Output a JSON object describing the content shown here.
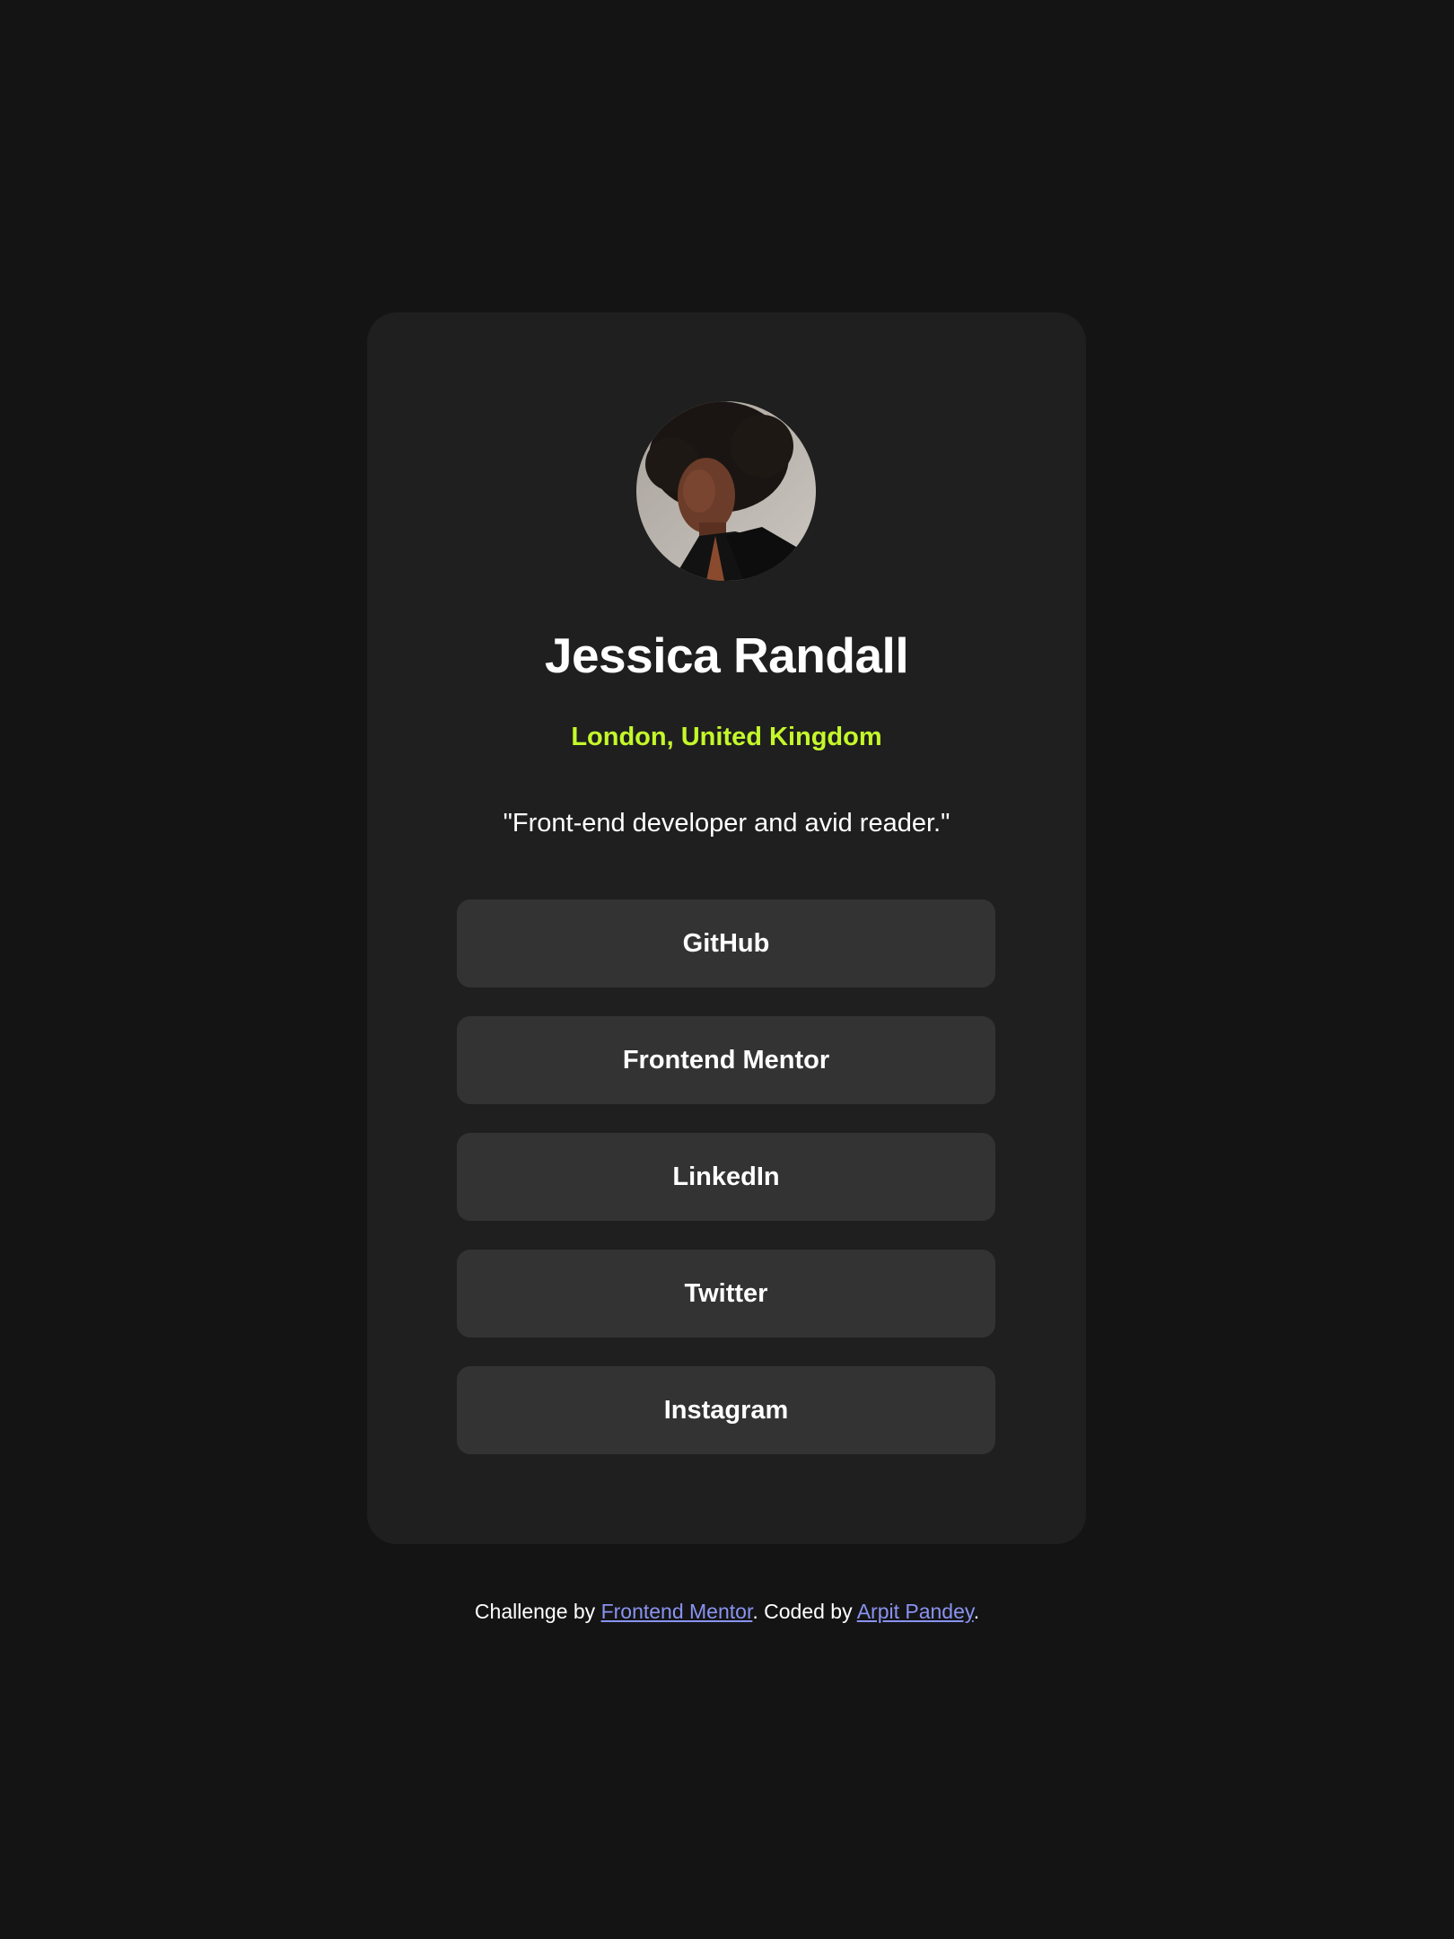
{
  "profile": {
    "name": "Jessica Randall",
    "location": "London, United Kingdom",
    "bio": "\"Front-end developer and avid reader.\"",
    "avatar_icon": "avatar-photo"
  },
  "links": [
    {
      "label": "GitHub"
    },
    {
      "label": "Frontend Mentor"
    },
    {
      "label": "LinkedIn"
    },
    {
      "label": "Twitter"
    },
    {
      "label": "Instagram"
    }
  ],
  "footer": {
    "prefix": "Challenge by ",
    "link1": "Frontend Mentor",
    "middle": ". Coded by ",
    "link2": "Arpit Pandey",
    "suffix": "."
  },
  "colors": {
    "background": "#141414",
    "card": "#1f1f1f",
    "button": "#333333",
    "accent": "#c4f82a",
    "link": "#8a93f0"
  }
}
